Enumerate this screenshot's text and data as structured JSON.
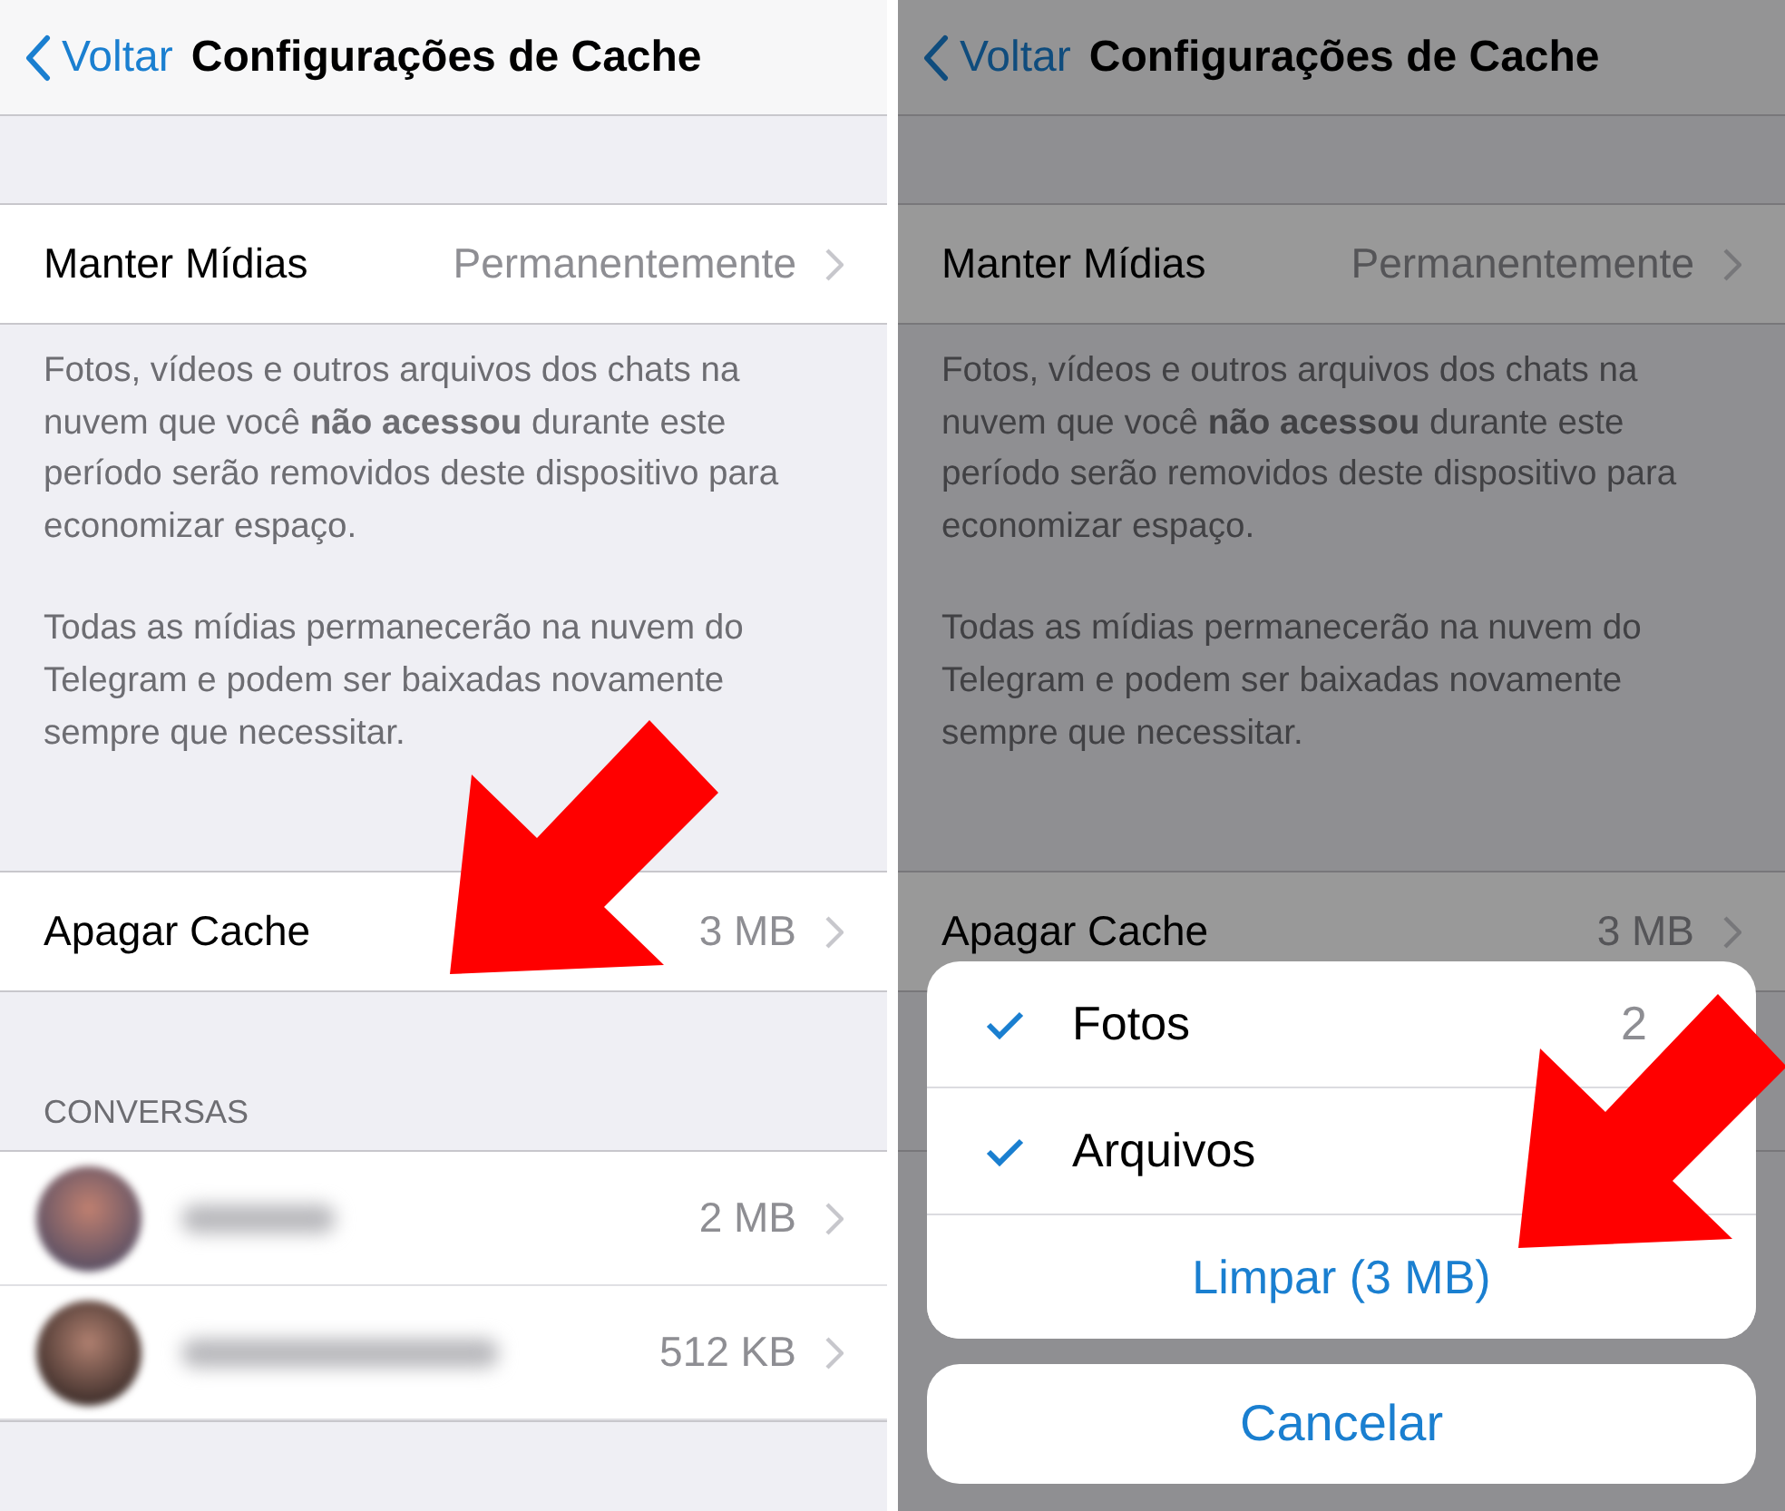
{
  "panels": [
    {
      "dimmed": false,
      "back": "Voltar",
      "title": "Configurações de Cache",
      "keep_media": {
        "label": "Manter Mídias",
        "value": "Permanentemente"
      },
      "description": [
        "Fotos, vídeos e outros arquivos dos chats na nuvem que você **não acessou** durante este período serão removidos deste dispositivo para economizar espaço.",
        "Todas as mídias permanecerão na nuvem do Telegram e podem ser baixadas novamente sempre que necessitar."
      ],
      "clear_cache": {
        "label": "Apagar Cache",
        "value": "3 MB"
      },
      "section_header": "CONVERSAS",
      "conversations": [
        {
          "kind": "blurred",
          "size": "2 MB"
        },
        {
          "kind": "blurred",
          "size": "512 KB"
        }
      ],
      "annotation_arrow": true
    },
    {
      "dimmed": true,
      "back": "Voltar",
      "title": "Configurações de Cache",
      "keep_media": {
        "label": "Manter Mídias",
        "value": "Permanentemente"
      },
      "description": [
        "Fotos, vídeos e outros arquivos dos chats na nuvem que você **não acessou** durante este período serão removidos deste dispositivo para economizar espaço.",
        "Todas as mídias permanecerão na nuvem do Telegram e podem ser baixadas novamente sempre que necessitar."
      ],
      "clear_cache": {
        "label": "Apagar Cache",
        "value": "3 MB"
      },
      "sheet": {
        "options": [
          {
            "label": "Fotos",
            "checked": true,
            "value": "2"
          },
          {
            "label": "Arquivos",
            "checked": true
          }
        ],
        "action": "Limpar (3 MB)",
        "cancel": "Cancelar"
      },
      "annotation_arrow": true
    }
  ]
}
